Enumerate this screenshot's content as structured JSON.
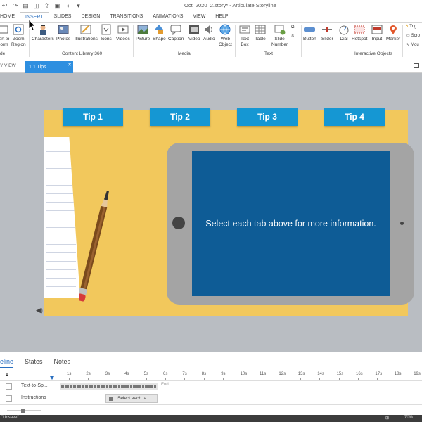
{
  "app": {
    "title": "Oct_2020_2.story* - Articulate Storyline"
  },
  "ribbon_tabs": [
    "HOME",
    "INSERT",
    "SLIDES",
    "DESIGN",
    "TRANSITIONS",
    "ANIMATIONS",
    "VIEW",
    "HELP"
  ],
  "active_tab": "INSERT",
  "ribbon": {
    "left_partial": {
      "insert": "ert to",
      "form": "orm",
      "zoom1": "Zoom",
      "zoom2": "Region",
      "de": "de"
    },
    "content_library": {
      "items": [
        "Characters",
        "Photos",
        "Illustrations",
        "Icons",
        "Videos"
      ],
      "label": "Content Library 360"
    },
    "media": {
      "items": [
        "Picture",
        "Shape",
        "Caption",
        "Video",
        "Audio"
      ],
      "web1": "Web",
      "web2": "Object",
      "label": "Media"
    },
    "text_group": {
      "textbox1": "Text",
      "textbox2": "Box",
      "table": "Table",
      "slidenum1": "Slide",
      "slidenum2": "Number",
      "label": "Text"
    },
    "interactive": {
      "items": [
        "Button",
        "Slider",
        "Dial",
        "Hotspot",
        "Input",
        "Marker"
      ],
      "label": "Interactive Objects"
    },
    "right_mini": [
      "Trig",
      "Scro",
      "Mou"
    ]
  },
  "views": {
    "story_view": "Y VIEW",
    "slide_tab": "1.1 Tips"
  },
  "slide": {
    "tips": [
      "Tip 1",
      "Tip 2",
      "Tip 3",
      "Tip 4"
    ],
    "screen_text": "Select each tab above for more information."
  },
  "bottom_panel": {
    "tabs": [
      "eline",
      "States",
      "Notes"
    ],
    "active_tab": "eline",
    "ticks": [
      "1s",
      "2s",
      "3s",
      "4s",
      "5s",
      "6s",
      "7s",
      "8s",
      "9s",
      "10s",
      "11s",
      "12s",
      "13s",
      "14s",
      "15s",
      "16s",
      "17s",
      "18s",
      "19s"
    ],
    "tracks": [
      {
        "name": "Text-to-Sp..."
      },
      {
        "name": "Instructions",
        "bar_text": "Select each ta..."
      }
    ],
    "end_label": "End"
  },
  "status": {
    "left": "\"Unsave\"",
    "zoom": "70%"
  },
  "colors": {
    "accent": "#2e8fe0",
    "tip_button": "#1597d3",
    "slide_bg": "#f2c85c",
    "screen": "#0e5c96",
    "tablet": "#a4a4a4"
  }
}
